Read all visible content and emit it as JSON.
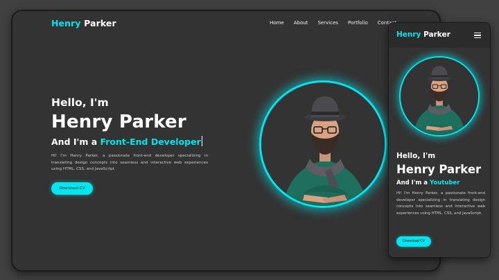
{
  "colors": {
    "accent": "#00e5ef",
    "background": "#333333",
    "page": "#414141",
    "text": "#ffffff"
  },
  "brand": {
    "first": "Henry",
    "last": "Parker"
  },
  "nav": {
    "items": [
      "Home",
      "About",
      "Services",
      "Portfolio",
      "Contact"
    ]
  },
  "hero": {
    "greeting": "Hello, I'm",
    "name": "Henry Parker",
    "role_prefix": "And I'm a",
    "role": "Front-End Developer",
    "description": "Hi! I'm Henry Parker, a passionate front-end developer specializing in translating design concepts into seamless and interactive web experiences using HTML, CSS, and JavaScript.",
    "cta": "Download CV"
  },
  "mobile": {
    "role": "Youtuber",
    "menu_icon": "hamburger-menu-icon"
  }
}
